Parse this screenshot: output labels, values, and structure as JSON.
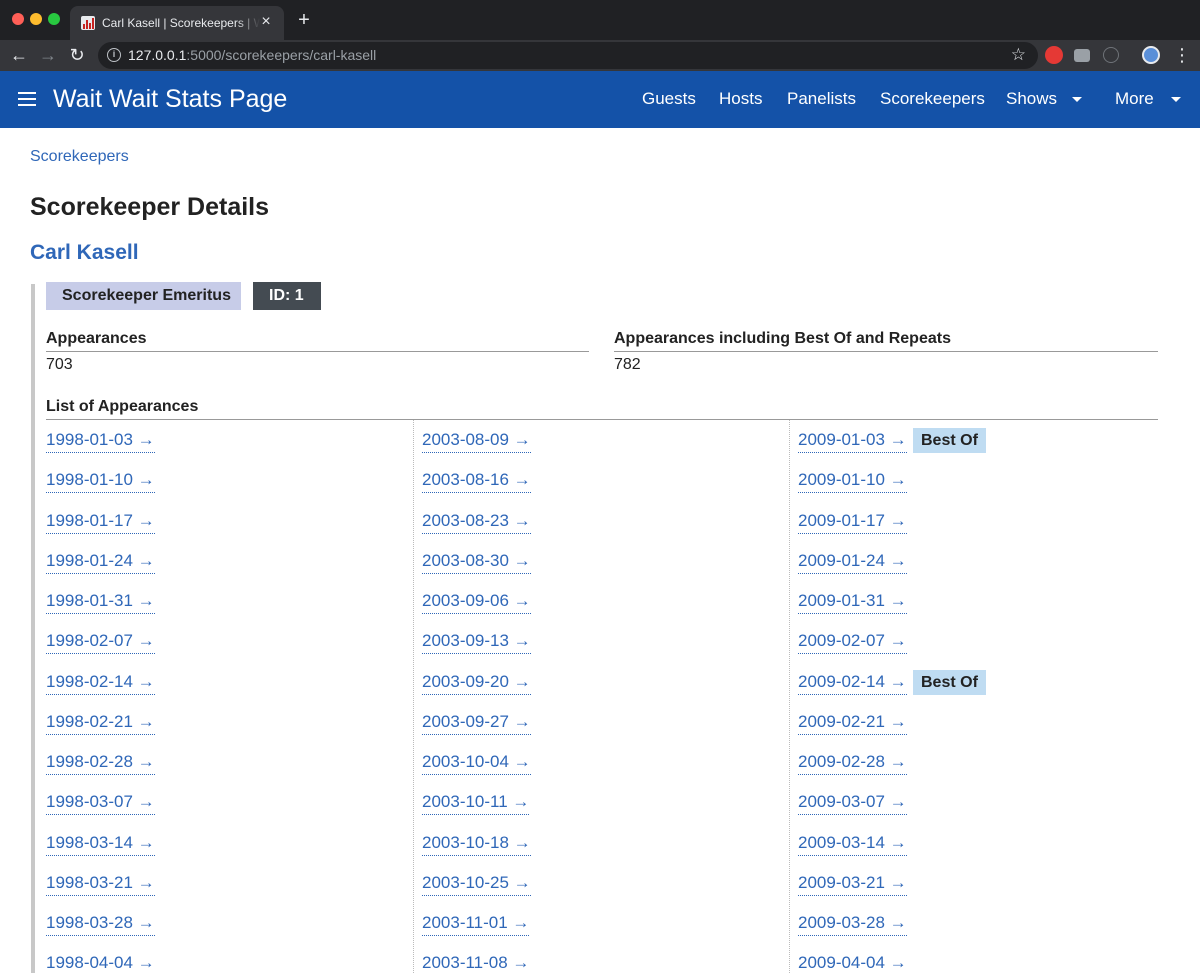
{
  "browser": {
    "tab_title": "Carl Kasell | Scorekeepers | Wait Wait Stats Page",
    "url_host": "127.0.0.1",
    "url_path": ":5000/scorekeepers/carl-kasell",
    "new_tab_glyph": "+",
    "close_glyph": "×"
  },
  "navbar": {
    "site_title": "Wait Wait Stats Page",
    "links": [
      "Guests",
      "Hosts",
      "Panelists",
      "Scorekeepers",
      "Shows",
      "More"
    ]
  },
  "breadcrumb": "Scorekeepers",
  "page_title": "Scorekeeper Details",
  "scorekeeper": {
    "name": "Carl Kasell",
    "badge": "Scorekeeper Emeritus",
    "id_label": "ID: 1"
  },
  "stats": {
    "appearances_label": "Appearances",
    "appearances_value": "703",
    "appearances_all_label": "Appearances including Best Of and Repeats",
    "appearances_all_value": "782"
  },
  "appearances": {
    "label": "List of Appearances",
    "best_of_label": "Best Of",
    "columns": [
      [
        {
          "date": "1998-01-03 →"
        },
        {
          "date": "1998-01-10 →"
        },
        {
          "date": "1998-01-17 →"
        },
        {
          "date": "1998-01-24 →"
        },
        {
          "date": "1998-01-31 →"
        },
        {
          "date": "1998-02-07 →"
        },
        {
          "date": "1998-02-14 →"
        },
        {
          "date": "1998-02-21 →"
        },
        {
          "date": "1998-02-28 →"
        },
        {
          "date": "1998-03-07 →"
        },
        {
          "date": "1998-03-14 →"
        },
        {
          "date": "1998-03-21 →"
        },
        {
          "date": "1998-03-28 →"
        },
        {
          "date": "1998-04-04 →"
        }
      ],
      [
        {
          "date": "2003-08-09 →"
        },
        {
          "date": "2003-08-16 →"
        },
        {
          "date": "2003-08-23 →"
        },
        {
          "date": "2003-08-30 →"
        },
        {
          "date": "2003-09-06 →"
        },
        {
          "date": "2003-09-13 →"
        },
        {
          "date": "2003-09-20 →"
        },
        {
          "date": "2003-09-27 →"
        },
        {
          "date": "2003-10-04 →"
        },
        {
          "date": "2003-10-11 →"
        },
        {
          "date": "2003-10-18 →"
        },
        {
          "date": "2003-10-25 →"
        },
        {
          "date": "2003-11-01 →"
        },
        {
          "date": "2003-11-08 →"
        }
      ],
      [
        {
          "date": "2009-01-03 →",
          "best_of": true
        },
        {
          "date": "2009-01-10 →"
        },
        {
          "date": "2009-01-17 →"
        },
        {
          "date": "2009-01-24 →"
        },
        {
          "date": "2009-01-31 →"
        },
        {
          "date": "2009-02-07 →"
        },
        {
          "date": "2009-02-14 →",
          "best_of": true
        },
        {
          "date": "2009-02-21 →"
        },
        {
          "date": "2009-02-28 →"
        },
        {
          "date": "2009-03-07 →"
        },
        {
          "date": "2009-03-14 →"
        },
        {
          "date": "2009-03-21 →"
        },
        {
          "date": "2009-03-28 →"
        },
        {
          "date": "2009-04-04 →"
        }
      ]
    ]
  }
}
